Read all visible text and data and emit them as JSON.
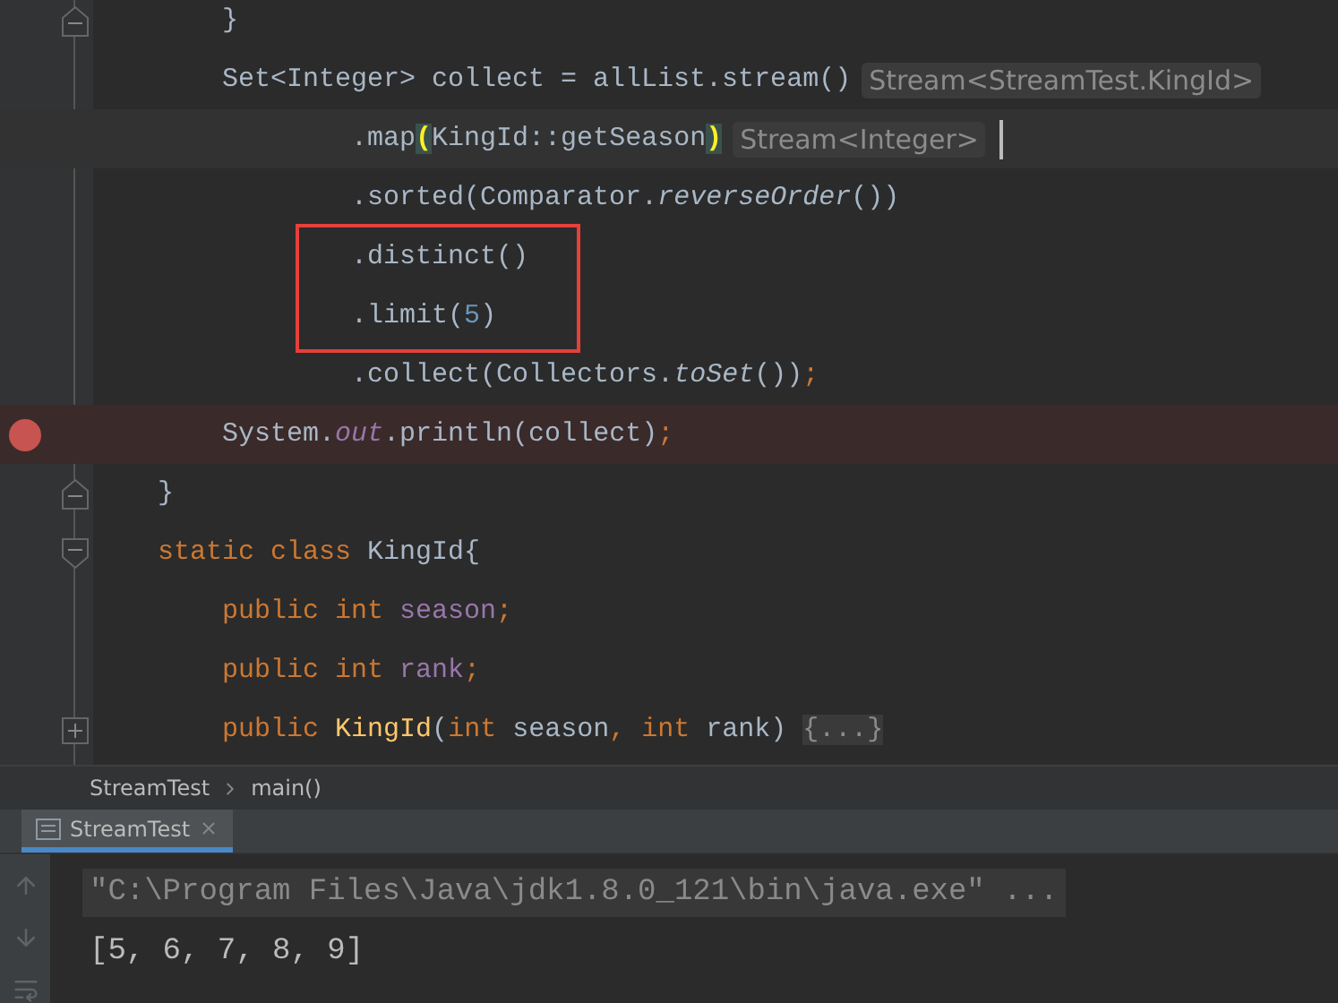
{
  "editor": {
    "lines": [
      {
        "kind": "closer",
        "breakpoint": false,
        "current": false,
        "boxed": false,
        "tokens": [
          {
            "kind": "plain",
            "text": "        }"
          }
        ]
      },
      {
        "kind": "plain",
        "breakpoint": false,
        "current": false,
        "boxed": false,
        "tokens": [
          {
            "kind": "plain",
            "text": "        Set<Integer> collect = allList.stream()"
          },
          {
            "kind": "hint",
            "text": "Stream<StreamTest.KingId>"
          }
        ]
      },
      {
        "kind": "plain",
        "breakpoint": false,
        "current": true,
        "boxed": false,
        "tokens": [
          {
            "kind": "plain",
            "text": "                .map"
          },
          {
            "kind": "brace-match",
            "text": "("
          },
          {
            "kind": "plain",
            "text": "KingId::getSeason"
          },
          {
            "kind": "brace-match",
            "text": ")"
          },
          {
            "kind": "hint",
            "text": "Stream<Integer>"
          }
        ]
      },
      {
        "kind": "plain",
        "breakpoint": false,
        "current": false,
        "boxed": false,
        "tokens": [
          {
            "kind": "plain",
            "text": "                .sorted(Comparator."
          },
          {
            "kind": "italic",
            "text": "reverseOrder"
          },
          {
            "kind": "plain",
            "text": "())"
          }
        ]
      },
      {
        "kind": "plain",
        "breakpoint": false,
        "current": false,
        "boxed": true,
        "tokens": [
          {
            "kind": "plain",
            "text": "                .distinct()"
          }
        ]
      },
      {
        "kind": "plain",
        "breakpoint": false,
        "current": false,
        "boxed": true,
        "tokens": [
          {
            "kind": "plain",
            "text": "                .limit("
          },
          {
            "kind": "number",
            "text": "5"
          },
          {
            "kind": "plain",
            "text": ")"
          }
        ]
      },
      {
        "kind": "plain",
        "breakpoint": false,
        "current": false,
        "boxed": false,
        "tokens": [
          {
            "kind": "plain",
            "text": "                .collect(Collectors."
          },
          {
            "kind": "italic",
            "text": "toSet"
          },
          {
            "kind": "plain",
            "text": "())"
          },
          {
            "kind": "punct",
            "text": ";"
          }
        ]
      },
      {
        "kind": "plain",
        "breakpoint": true,
        "current": false,
        "boxed": false,
        "tokens": [
          {
            "kind": "plain",
            "text": "        System."
          },
          {
            "kind": "static-field",
            "text": "out"
          },
          {
            "kind": "plain",
            "text": ".println(collect)"
          },
          {
            "kind": "punct",
            "text": ";"
          }
        ]
      },
      {
        "kind": "closer",
        "breakpoint": false,
        "current": false,
        "boxed": false,
        "tokens": [
          {
            "kind": "plain",
            "text": "    }"
          }
        ]
      },
      {
        "kind": "opener",
        "breakpoint": false,
        "current": false,
        "boxed": false,
        "tokens": [
          {
            "kind": "keyword",
            "text": "    static class "
          },
          {
            "kind": "plain",
            "text": "KingId{"
          }
        ]
      },
      {
        "kind": "plain",
        "breakpoint": false,
        "current": false,
        "boxed": false,
        "tokens": [
          {
            "kind": "keyword",
            "text": "        public int "
          },
          {
            "kind": "field",
            "text": "season"
          },
          {
            "kind": "punct",
            "text": ";"
          }
        ]
      },
      {
        "kind": "plain",
        "breakpoint": false,
        "current": false,
        "boxed": false,
        "tokens": [
          {
            "kind": "keyword",
            "text": "        public int "
          },
          {
            "kind": "field",
            "text": "rank"
          },
          {
            "kind": "punct",
            "text": ";"
          }
        ]
      },
      {
        "kind": "collapsed",
        "breakpoint": false,
        "current": false,
        "boxed": false,
        "tokens": [
          {
            "kind": "keyword",
            "text": "        public "
          },
          {
            "kind": "method-decl",
            "text": "KingId"
          },
          {
            "kind": "plain",
            "text": "("
          },
          {
            "kind": "keyword",
            "text": "int "
          },
          {
            "kind": "plain",
            "text": "season"
          },
          {
            "kind": "punct",
            "text": ", "
          },
          {
            "kind": "keyword",
            "text": "int "
          },
          {
            "kind": "plain",
            "text": "rank) "
          },
          {
            "kind": "folded",
            "text": "{...}"
          }
        ]
      }
    ]
  },
  "breadcrumbs": [
    "StreamTest",
    "main()"
  ],
  "tool_tabs": [
    {
      "label": "StreamTest",
      "selected": true
    }
  ],
  "console": {
    "lines": [
      {
        "kind": "command",
        "text": "\"C:\\Program Files\\Java\\jdk1.8.0_121\\bin\\java.exe\" ..."
      },
      {
        "kind": "output",
        "text": "[5, 6, 7, 8, 9]"
      }
    ]
  }
}
